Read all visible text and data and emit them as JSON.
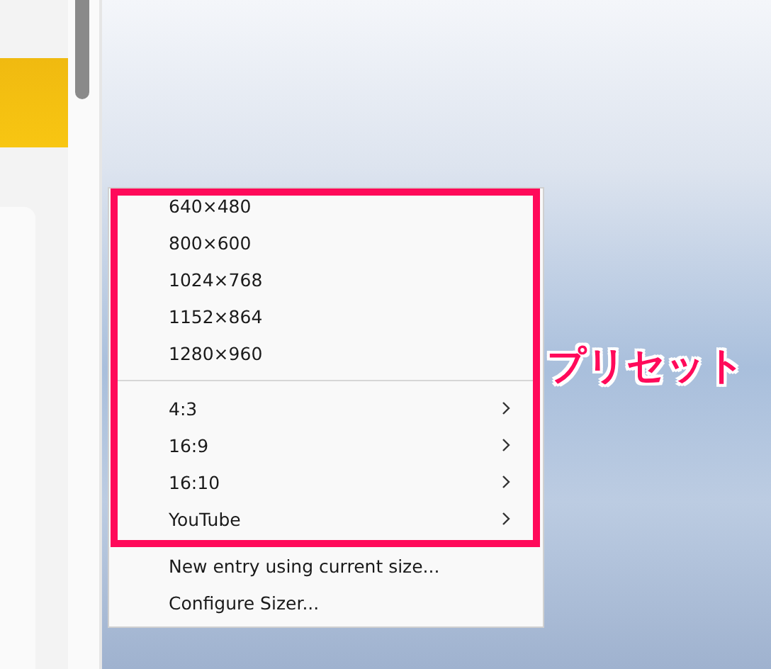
{
  "menu": {
    "highlight_box": {
      "items": [
        {
          "kind": "entry",
          "label": "640×480"
        },
        {
          "kind": "entry",
          "label": "800×600"
        },
        {
          "kind": "entry",
          "label": "1024×768"
        },
        {
          "kind": "entry",
          "label": "1152×864"
        },
        {
          "kind": "entry",
          "label": "1280×960"
        },
        {
          "kind": "separator"
        },
        {
          "kind": "submenu",
          "label": "4:3"
        },
        {
          "kind": "submenu",
          "label": "16:9"
        },
        {
          "kind": "submenu",
          "label": "16:10"
        },
        {
          "kind": "submenu",
          "label": "YouTube"
        }
      ]
    },
    "items": [
      {
        "kind": "entry",
        "label": "New entry using current size..."
      },
      {
        "kind": "entry",
        "label": "Configure Sizer..."
      }
    ]
  },
  "annotation": {
    "text": "プリセット"
  }
}
